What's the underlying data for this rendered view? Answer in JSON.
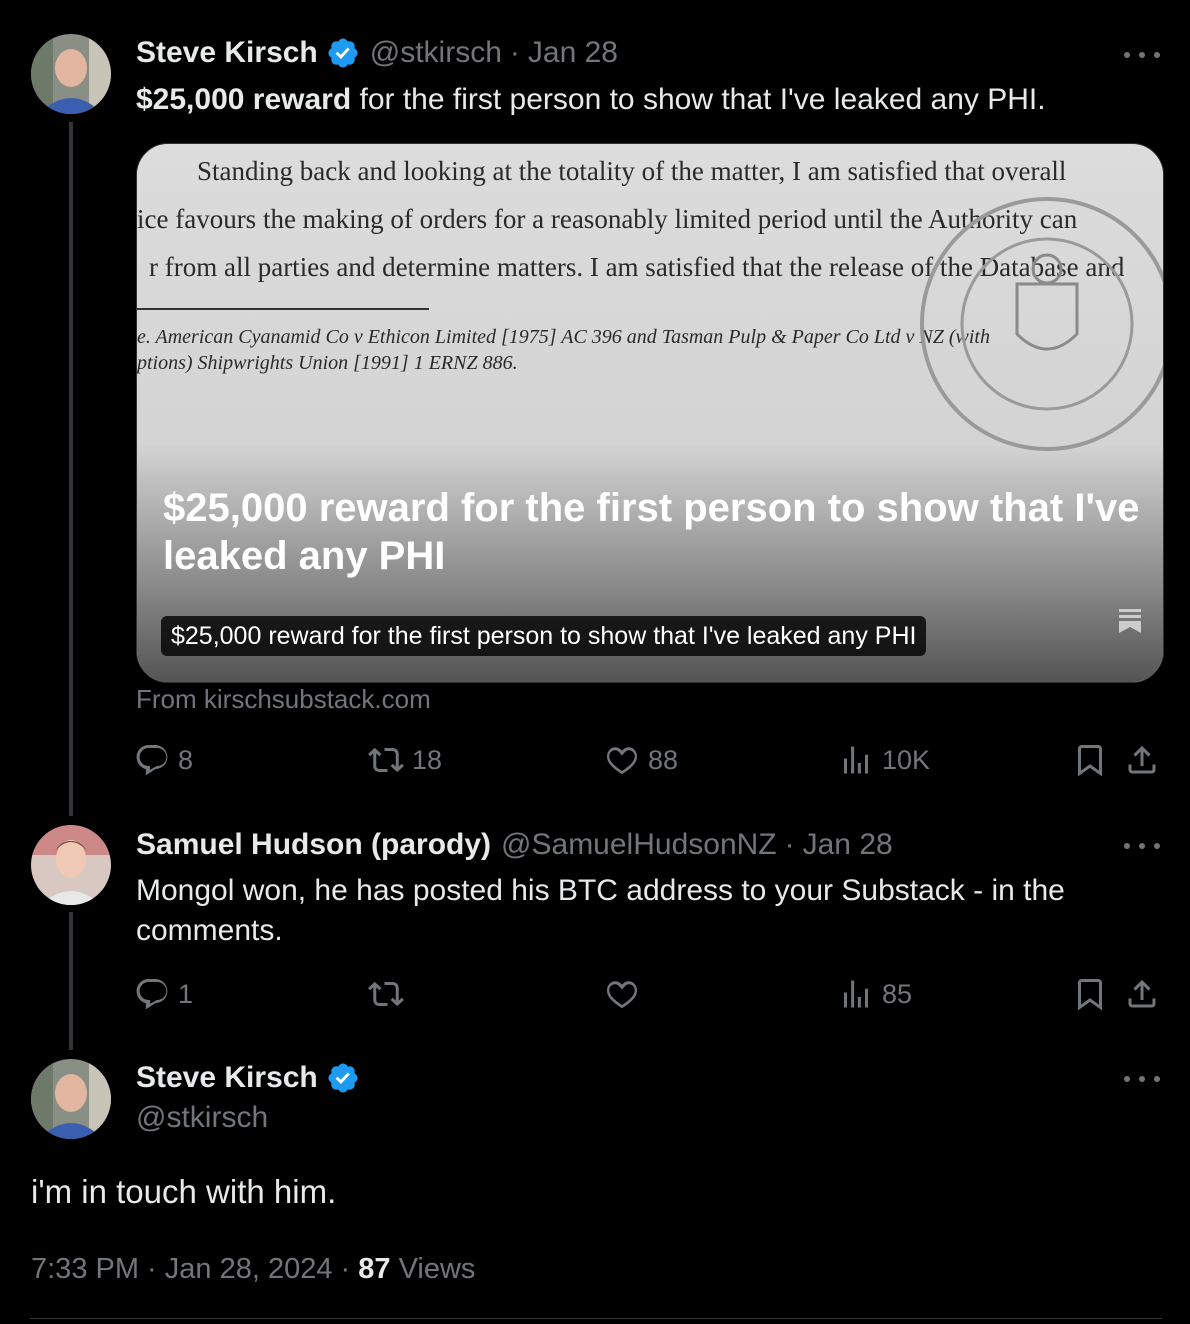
{
  "tweet1": {
    "name": "Steve Kirsch",
    "handle": "@stkirsch",
    "separator": "·",
    "date": "Jan 28",
    "text_bold": "$25,000 reward",
    "text_rest": " for the first person to show that I've leaked any PHI.",
    "card": {
      "doc_line1": "Standing back and looking at the totality of the matter, I am satisfied that overall",
      "doc_line2": "ice favours the making of orders for a reasonably limited period until the Authority can",
      "doc_line3": "r from all parties and determine matters. I am satisfied that the release of the Database and",
      "doc_fn1": "e. American Cyanamid Co v Ethicon Limited [1975] AC 396 and Tasman Pulp & Paper Co Ltd v NZ (with",
      "doc_fn2": "ptions) Shipwrights Union [1991] 1 ERNZ 886.",
      "title": "$25,000 reward for the first person to show that I've leaked any PHI",
      "pill": "$25,000 reward for the first person to show that I've leaked any PHI",
      "from": "From kirschsubstack.com"
    },
    "stats": {
      "replies": "8",
      "reposts": "18",
      "likes": "88",
      "views": "10K"
    }
  },
  "tweet2": {
    "name": "Samuel Hudson (parody)",
    "handle": "@SamuelHudsonNZ",
    "separator": "·",
    "date": "Jan 28",
    "text": "Mongol won, he has posted his BTC address to your Substack - in the comments.",
    "stats": {
      "replies": "1",
      "views": "85"
    }
  },
  "tweet3": {
    "name": "Steve Kirsch",
    "handle": "@stkirsch",
    "text": "i'm in touch with him.",
    "time": "7:33 PM · Jan 28, 2024 · ",
    "views_count": "87",
    "views_label": " Views"
  },
  "colors": {
    "verified": "#1d9bf0",
    "muted": "#71767b",
    "text": "#e7e9ea",
    "background": "#000000"
  }
}
